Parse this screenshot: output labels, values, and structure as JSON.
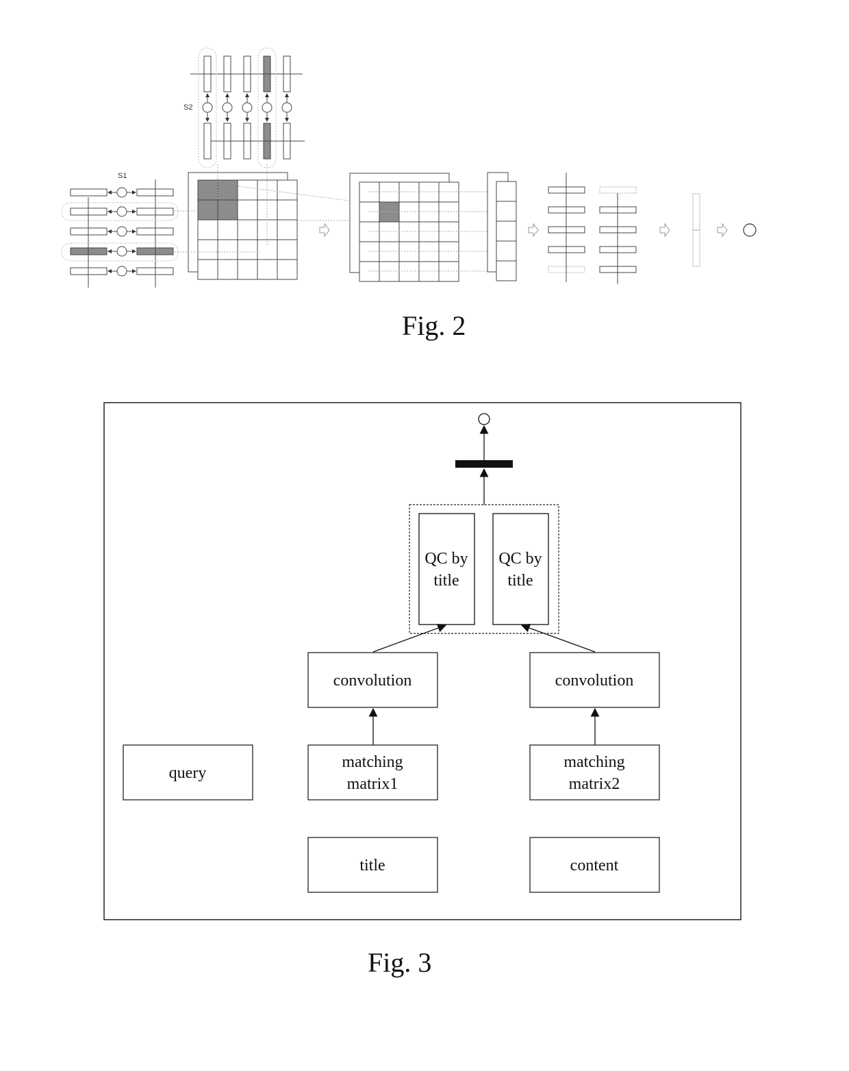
{
  "fig2": {
    "caption": "Fig. 2",
    "labels": {
      "s1": "S1",
      "s2": "S2"
    },
    "colors": {
      "highlight": "#8c8c8c",
      "stroke": "#333333",
      "dotted": "#aaaaaa"
    }
  },
  "fig3": {
    "caption": "Fig. 3",
    "nodes": {
      "qc_left": [
        "QC by",
        "title"
      ],
      "qc_right": [
        "QC by",
        "title"
      ],
      "conv_left": "convolution",
      "conv_right": "convolution",
      "match1": [
        "matching",
        "matrix1"
      ],
      "match2": [
        "matching",
        "matrix2"
      ],
      "query": "query",
      "title": "title",
      "content": "content"
    }
  }
}
